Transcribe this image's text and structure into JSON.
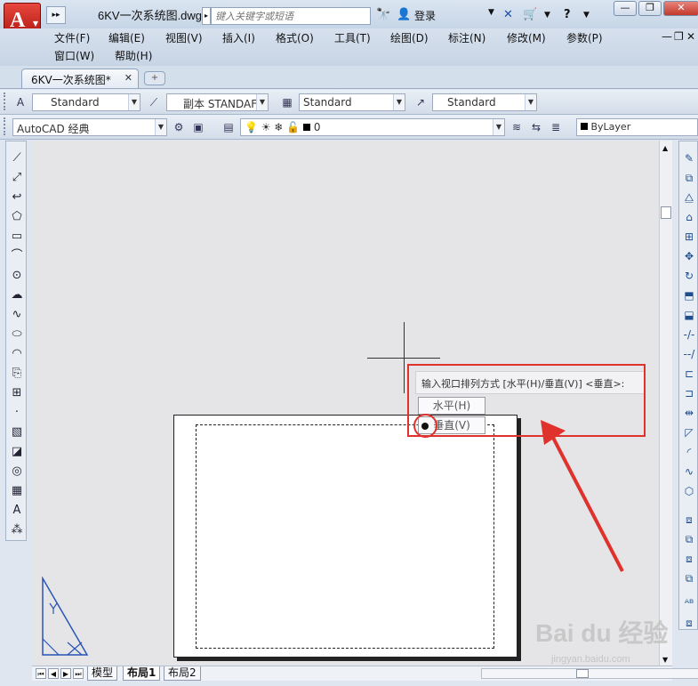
{
  "titlebar": {
    "doc_title": "6KV一次系统图.dwg",
    "search_placeholder": "键入关键字或短语",
    "login_label": "登录"
  },
  "menubar": {
    "row1": [
      "文件(F)",
      "编辑(E)",
      "视图(V)",
      "插入(I)",
      "格式(O)",
      "工具(T)",
      "绘图(D)",
      "标注(N)",
      "修改(M)",
      "参数(P)"
    ],
    "row2": [
      "窗口(W)",
      "帮助(H)"
    ]
  },
  "tabs": {
    "doc_tab_label": "6KV一次系统图*"
  },
  "styles_toolbar": {
    "text_style": "Standard",
    "dim_style": "副本 STANDAF",
    "table_style": "Standard",
    "multileader_style": "Standard"
  },
  "layers_toolbar": {
    "workspace": "AutoCAD 经典",
    "layer": "0",
    "color": "ByLayer"
  },
  "command_prompt": {
    "text": "输入视口排列方式 [水平(H)/垂直(V)] <垂直>:",
    "options": [
      {
        "label": "水平(H)",
        "selected": false
      },
      {
        "label": "垂直(V)",
        "selected": true
      }
    ]
  },
  "layout_tabs": [
    "模型",
    "布局1",
    "布局2"
  ],
  "watermark": {
    "text": "Bai du 经验",
    "sub": "jingyan.baidu.com"
  },
  "colors": {
    "highlight_red": "#e0322c",
    "app_red": "#c8201a"
  }
}
